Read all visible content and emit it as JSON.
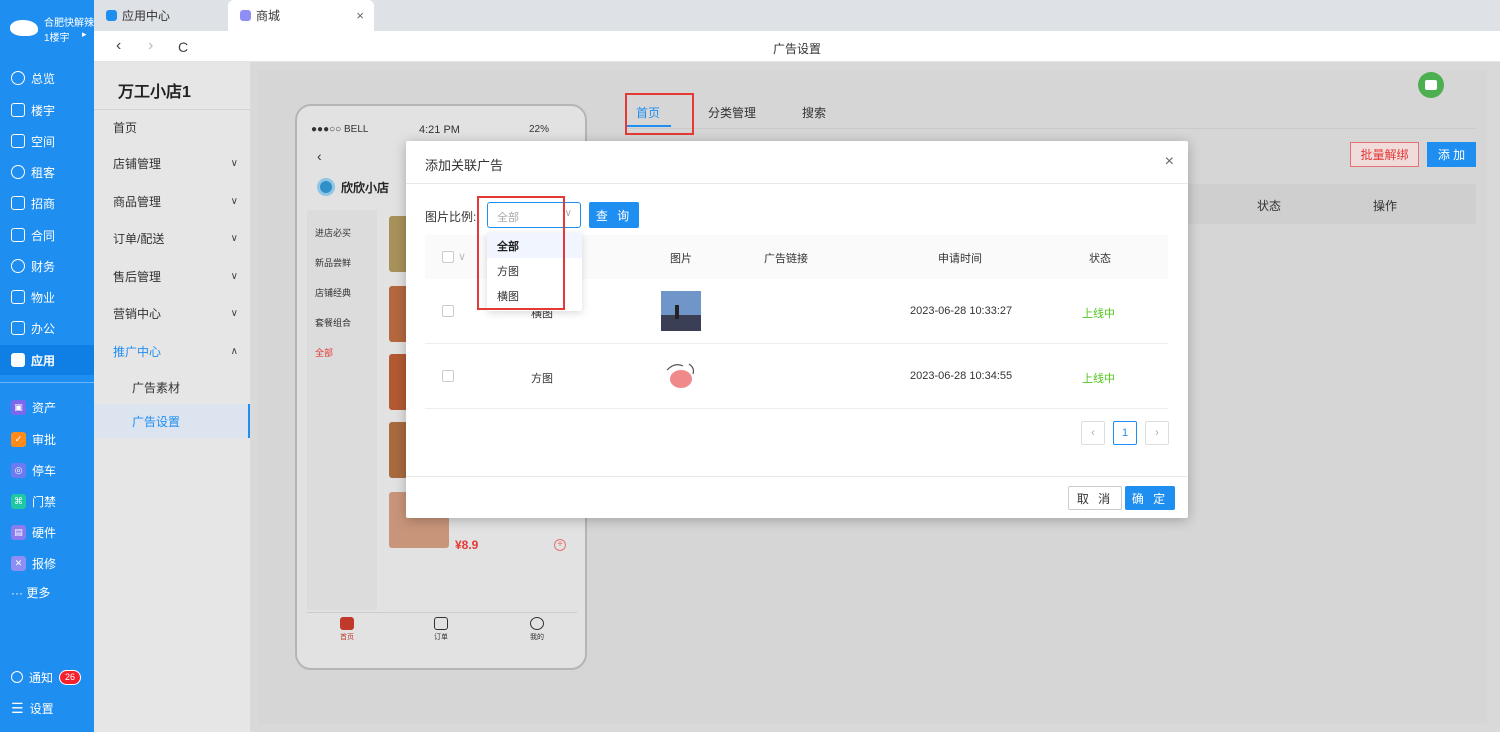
{
  "brand": {
    "line1": "合肥快解辣",
    "line2": "1楼宇"
  },
  "sidebar": {
    "items": [
      {
        "label": "总览",
        "icon": "dashboard-icon"
      },
      {
        "label": "楼宇",
        "icon": "building-icon"
      },
      {
        "label": "空间",
        "icon": "space-icon"
      },
      {
        "label": "租客",
        "icon": "tenant-icon"
      },
      {
        "label": "招商",
        "icon": "tag-icon"
      },
      {
        "label": "合同",
        "icon": "contract-icon"
      },
      {
        "label": "财务",
        "icon": "finance-icon"
      },
      {
        "label": "物业",
        "icon": "home-icon"
      },
      {
        "label": "办公",
        "icon": "monitor-icon"
      },
      {
        "label": "应用",
        "icon": "app-cube-icon"
      }
    ],
    "apps": [
      {
        "label": "资产",
        "color": "#7b68ee"
      },
      {
        "label": "审批",
        "color": "#ff8c1a"
      },
      {
        "label": "停车",
        "color": "#6c7bf0"
      },
      {
        "label": "门禁",
        "color": "#1fc7a4"
      },
      {
        "label": "硬件",
        "color": "#8a7cf0"
      },
      {
        "label": "报修",
        "color": "#8e8ef5"
      }
    ],
    "more": "··· 更多",
    "notify": {
      "label": "通知",
      "count": "26"
    },
    "settings": "设置"
  },
  "tabs": [
    {
      "label": "应用中心"
    },
    {
      "label": "商城"
    }
  ],
  "addressbar": {
    "title": "广告设置",
    "back": "‹",
    "forward": "›",
    "reload": "C"
  },
  "submenu": {
    "store": "万工小店1",
    "items": [
      "首页",
      "店铺管理",
      "商品管理",
      "订单/配送",
      "售后管理",
      "营销中心",
      "推广中心"
    ],
    "subs": [
      "广告素材",
      "广告设置"
    ]
  },
  "phone": {
    "carrier": "●●●○○ BELL",
    "time": "4:21 PM",
    "battery": "22%",
    "back": "‹",
    "store": "欣欣小店",
    "categories": [
      "进店必买",
      "新品尝鲜",
      "店铺经典",
      "套餐组合",
      "全部"
    ],
    "price": "¥8.9",
    "plus": "+",
    "bottom": [
      "首页",
      "订单",
      "我的"
    ]
  },
  "content_tabs": [
    "首页",
    "分类管理",
    "搜索"
  ],
  "actions": {
    "batch_unbind": "批量解绑",
    "add": "添 加"
  },
  "bg_table_headers": [
    "状态",
    "操作"
  ],
  "modal": {
    "title": "添加关联广告",
    "close": "×",
    "filter_label": "图片比例:",
    "select_value": "全部",
    "query_btn": "查 询",
    "headers": [
      "图片",
      "广告链接",
      "申请时间",
      "状态"
    ],
    "rows": [
      {
        "ratio": "横图",
        "time": "2023-06-28 10:33:27",
        "status": "上线中"
      },
      {
        "ratio": "方图",
        "time": "2023-06-28 10:34:55",
        "status": "上线中"
      }
    ],
    "pager": {
      "prev": "‹",
      "page": "1",
      "next": "›"
    },
    "cancel": "取 消",
    "ok": "确 定"
  },
  "dropdown": {
    "options": [
      "全部",
      "方图",
      "横图"
    ],
    "selected": "全部"
  }
}
